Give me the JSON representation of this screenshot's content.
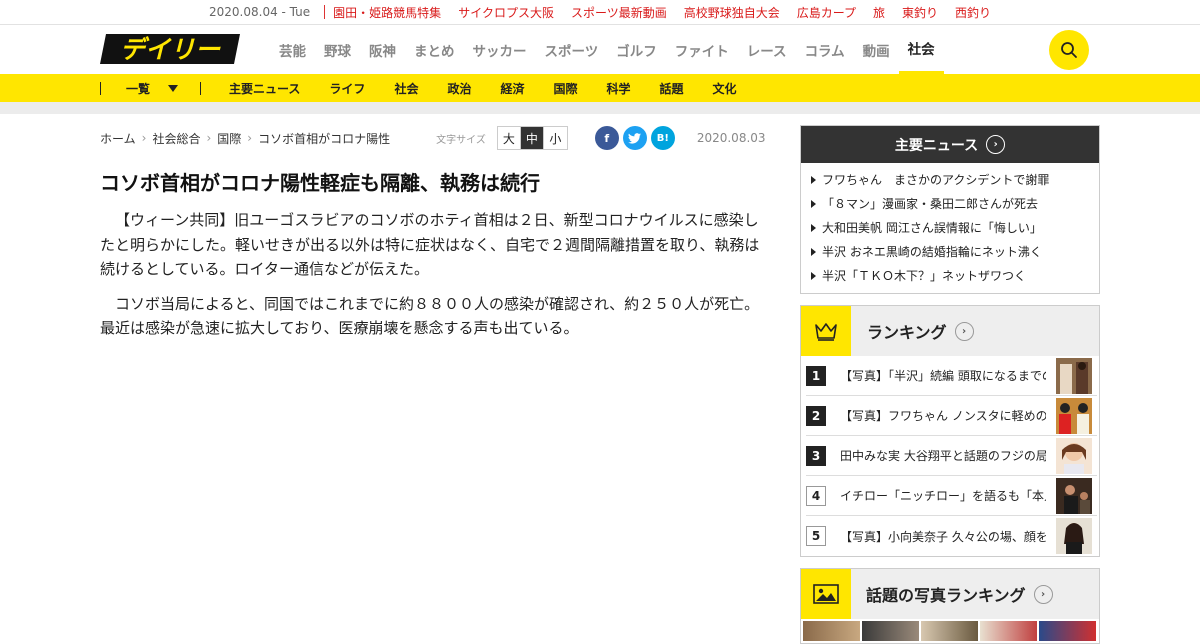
{
  "topbar": {
    "date": "2020.08.04 - Tue",
    "links": [
      "園田・姫路競馬特集",
      "サイクロプス大阪",
      "スポーツ最新動画",
      "高校野球独自大会",
      "広島カープ",
      "旅",
      "東釣り",
      "西釣り"
    ]
  },
  "header": {
    "logo_text": "デイリー",
    "nav": [
      "芸能",
      "野球",
      "阪神",
      "まとめ",
      "サッカー",
      "スポーツ",
      "ゴルフ",
      "ファイト",
      "レース",
      "コラム",
      "動画",
      "社会"
    ],
    "active_nav": "社会"
  },
  "subnav": {
    "dropdown_label": "一覧",
    "items": [
      "主要ニュース",
      "ライフ",
      "社会",
      "政治",
      "経済",
      "国際",
      "科学",
      "話題",
      "文化"
    ]
  },
  "article": {
    "breadcrumbs": [
      "ホーム",
      "社会総合",
      "国際",
      "コソボ首相がコロナ陽性"
    ],
    "font_size_label": "文字サイズ",
    "font_sizes": [
      "大",
      "中",
      "小"
    ],
    "font_size_selected": "中",
    "share": [
      "f",
      "t",
      "B!"
    ],
    "date": "2020.08.03",
    "headline": "コソボ首相がコロナ陽性軽症も隔離、執務は続行",
    "paragraphs": [
      "【ウィーン共同】旧ユーゴスラビアのコソボのホティ首相は２日、新型コロナウイルスに感染したと明らかにした。軽いせきが出る以外は特に症状はなく、自宅で２週間隔離措置を取り、執務は続けるとしている。ロイター通信などが伝えた。",
      "コソボ当局によると、同国ではこれまでに約８８００人の感染が確認され、約２５０人が死亡。最近は感染が急速に拡大しており、医療崩壊を懸念する声も出ている。"
    ]
  },
  "sidebar": {
    "main_news": {
      "title": "主要ニュース",
      "items": [
        "フワちゃん　まさかのアクシデントで謝罪",
        "「８マン」漫画家・桑田二郎さんが死去",
        "大和田美帆 岡江さん誤情報に「悔しい」",
        "半沢 おネエ黒崎の結婚指輪にネット沸く",
        "半沢「ＴＫＯ木下？」ネットザワつく"
      ]
    },
    "ranking": {
      "title": "ランキング",
      "items": [
        {
          "rank": "1",
          "title": "【写真】「半沢」続編 頭取になるまでの歩み"
        },
        {
          "rank": "2",
          "title": "【写真】フワちゃん ノンスタに軽めの謝罪"
        },
        {
          "rank": "3",
          "title": "田中みな実 大谷翔平と話題のフジの局アナ"
        },
        {
          "rank": "4",
          "title": "イチロー「ニッチロー」を語るも「本人は」"
        },
        {
          "rank": "5",
          "title": "【写真】小向美奈子 久々公の場、顔を見せ"
        }
      ]
    },
    "photo_ranking": {
      "title": "話題の写真ランキング"
    }
  },
  "colors": {
    "brand_yellow": "#ffe600",
    "link_red": "#d91a1a",
    "header_dark": "#333333"
  }
}
